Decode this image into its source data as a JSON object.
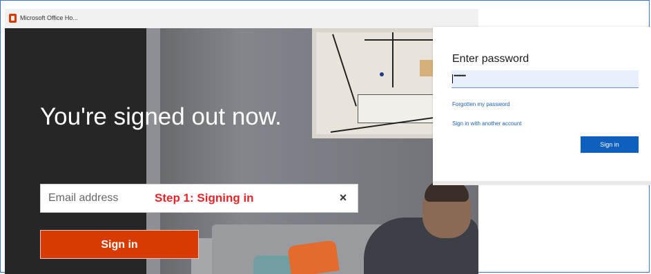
{
  "browser": {
    "tab_title": "Microsoft Office Ho..."
  },
  "hero": {
    "title": "You're signed out now.",
    "email_placeholder": "Email address",
    "step_label": "Step 1: Signing in",
    "clear_icon": "×",
    "signin_label": "Sign in"
  },
  "password_card": {
    "heading": "Enter password",
    "password_value": "••••••••",
    "forgot_link": "Forgotten my password",
    "other_account_link": "Sign in with another account",
    "signin_label": "Sign in"
  },
  "colors": {
    "office_orange": "#d83b01",
    "step_red": "#e5252a",
    "link_blue": "#1b61b5",
    "primary_blue": "#0f5fbf"
  }
}
